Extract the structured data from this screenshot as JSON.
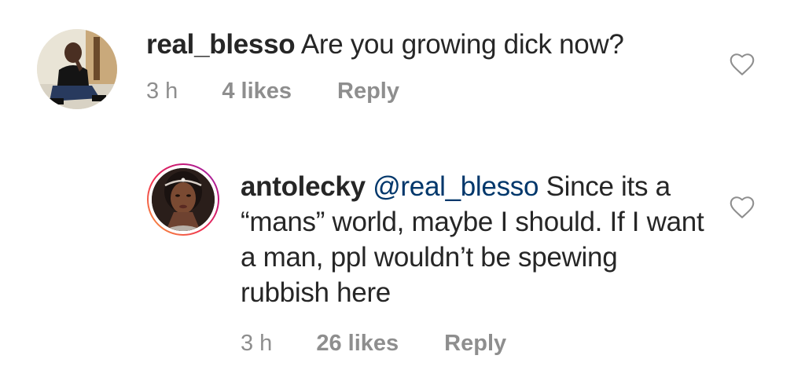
{
  "comments": [
    {
      "username": "real_blesso",
      "mention": "",
      "text": "Are you growing dick now?",
      "time": "3 h",
      "likes": "4 likes",
      "reply_label": "Reply",
      "avatar_icon": "user-avatar",
      "like_icon": "heart-outline-icon"
    },
    {
      "username": "antolecky",
      "mention": "@real_blesso",
      "text": "Since its a “mans” world, maybe I should. If I want a man, ppl wouldn’t be spewing rubbish here",
      "time": "3 h",
      "likes": "26 likes",
      "reply_label": "Reply",
      "avatar_icon": "user-avatar-story-ring",
      "like_icon": "heart-outline-icon"
    }
  ],
  "colors": {
    "text": "#262626",
    "meta": "#8e8e8e",
    "mention": "#00376b",
    "story_ring_start": "#f9a33b",
    "story_ring_end": "#8a2ec2"
  }
}
